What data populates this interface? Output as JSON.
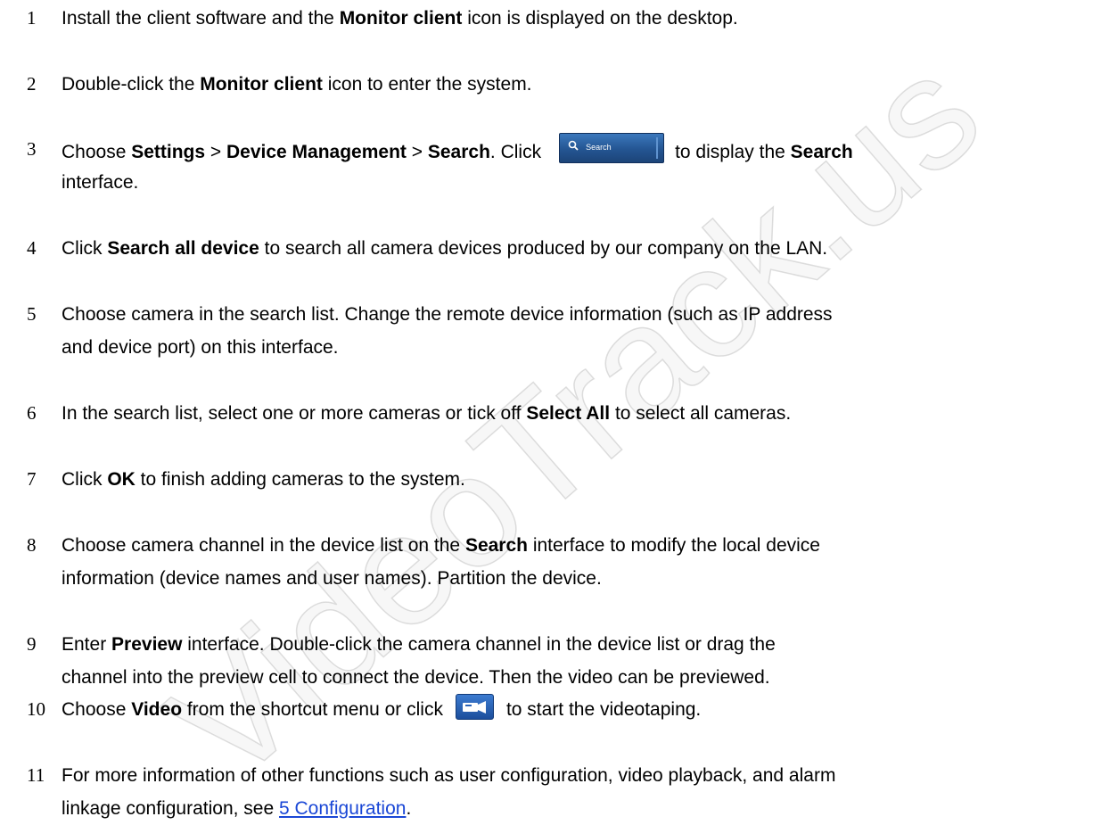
{
  "watermark": "VideoTrack.us",
  "steps": [
    {
      "num": "1",
      "parts": [
        "Install the client software and the ",
        "Monitor client",
        " icon is displayed on the desktop."
      ]
    },
    {
      "num": "2",
      "parts": [
        "Double-click the ",
        "Monitor client",
        " icon to enter the system."
      ]
    },
    {
      "num": "3",
      "parts": [
        "Choose ",
        "Settings",
        " > ",
        "Device Management",
        " > ",
        "Search",
        ". Click",
        "to display the ",
        "Search",
        "interface."
      ],
      "button_label": "Search"
    },
    {
      "num": "4",
      "parts": [
        "Click ",
        "Search all device",
        " to search all camera devices produced by our company on the LAN."
      ]
    },
    {
      "num": "5",
      "parts": [
        "Choose camera in the search list. Change the remote device information (such as IP address",
        "and device port) on this interface."
      ]
    },
    {
      "num": "6",
      "parts": [
        "In the search list, select one or more cameras or tick off ",
        "Select All",
        " to select all cameras."
      ]
    },
    {
      "num": "7",
      "parts": [
        "Click ",
        "OK",
        " to finish adding cameras to the system."
      ]
    },
    {
      "num": "8",
      "parts": [
        "Choose camera channel in the device list on the ",
        "Search",
        " interface to modify the local device",
        "information (device names and user names). Partition the device."
      ]
    },
    {
      "num": "9",
      "parts": [
        "Enter ",
        "Preview",
        " interface. Double-click the camera channel in the device list or drag the",
        "channel into the preview cell to connect the device. Then the video can be previewed."
      ]
    },
    {
      "num": "10",
      "parts": [
        "Choose ",
        "Video",
        " from the shortcut menu or click",
        "to start the videotaping."
      ]
    },
    {
      "num": "11",
      "parts": [
        "For more information of other functions such as user configuration, video playback, and alarm",
        "linkage configuration, see ",
        "5 Configuration",
        "."
      ]
    }
  ]
}
